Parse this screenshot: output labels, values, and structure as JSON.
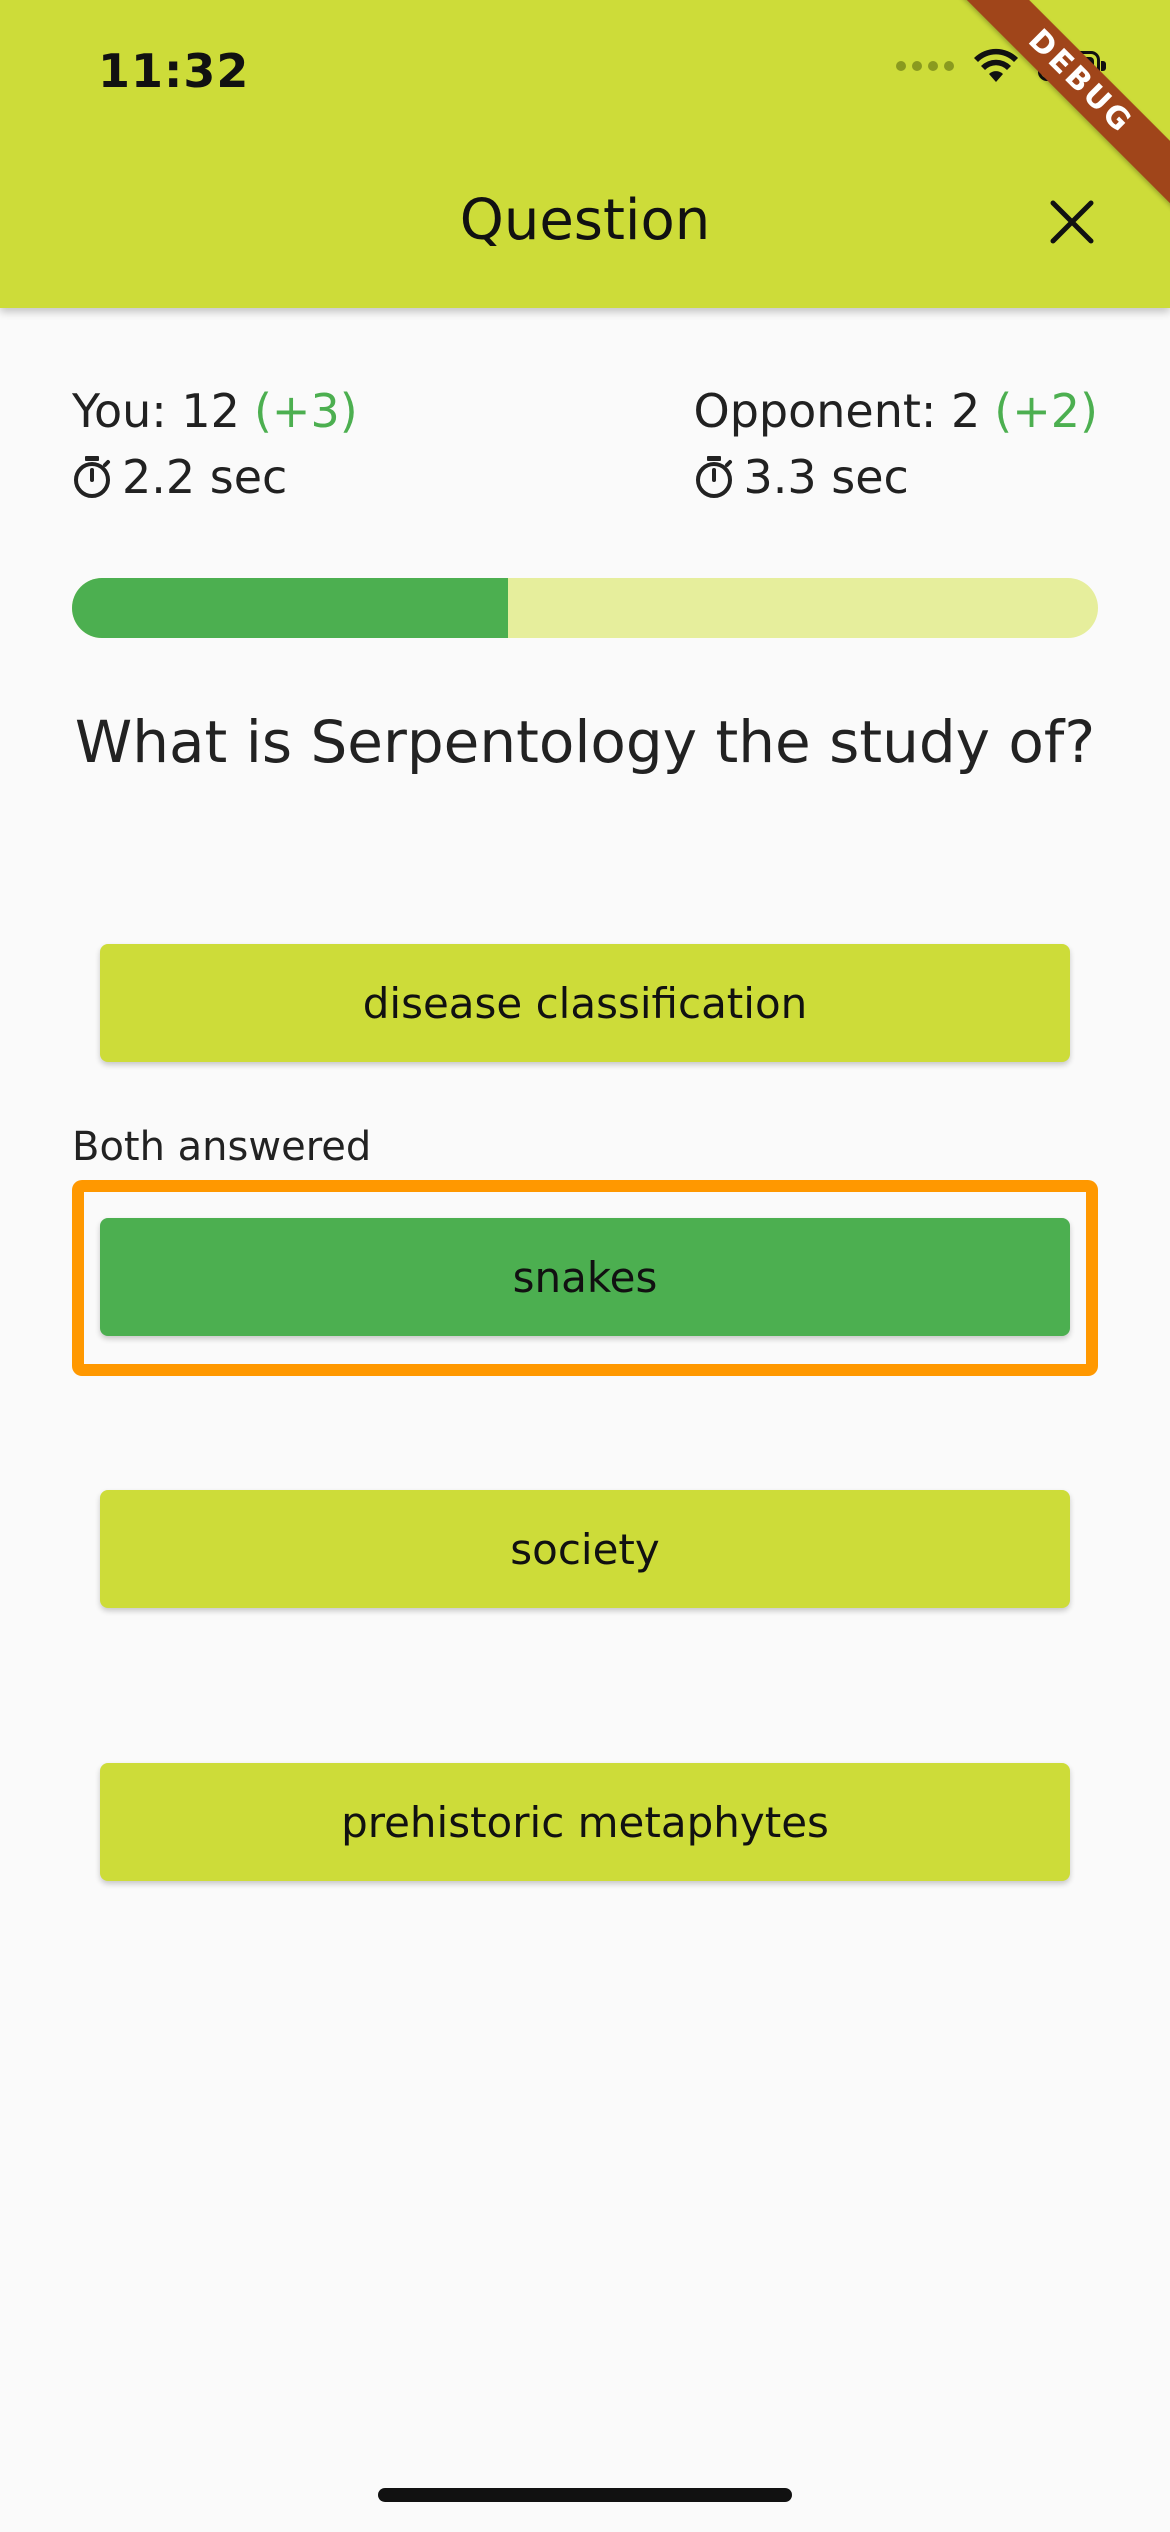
{
  "status_bar": {
    "time": "11:32"
  },
  "debug_banner": "DEBUG",
  "appbar": {
    "title": "Question",
    "close_icon": "close-icon"
  },
  "colors": {
    "primary": "#cddc39",
    "correct": "#4caf50",
    "highlight": "#ff9800",
    "progress_track": "#e6ee9c"
  },
  "scores": {
    "you": {
      "label": "You: 12",
      "bonus": "(+3)",
      "time": "2.2 sec"
    },
    "opponent": {
      "label": "Opponent: 2",
      "bonus": "(+2)",
      "time": "3.3 sec"
    }
  },
  "progress": {
    "fraction": 0.425
  },
  "question": "What is Serpentology the study of?",
  "answers": [
    {
      "label": "disease classification",
      "state": "default"
    },
    {
      "label": "snakes",
      "state": "correct",
      "note": "Both answered"
    },
    {
      "label": "society",
      "state": "default"
    },
    {
      "label": "prehistoric metaphytes",
      "state": "default"
    }
  ]
}
